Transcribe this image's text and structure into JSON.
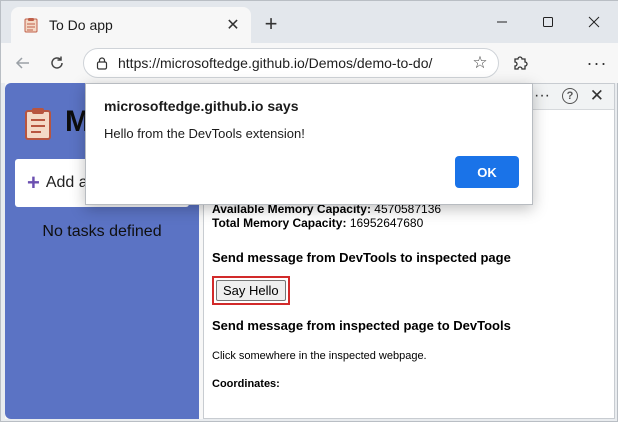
{
  "tab": {
    "title": "To Do app"
  },
  "toolbar": {
    "url": "https://microsoftedge.github.io/Demos/demo-to-do/"
  },
  "todo": {
    "heading": "M",
    "add_label": "Add a",
    "empty": "No tasks defined"
  },
  "devtools": {
    "memory": [
      {
        "label": "Available Memory Capacity:",
        "value": "4570587136"
      },
      {
        "label": "Total Memory Capacity:",
        "value": "16952647680"
      }
    ],
    "send_to_page_heading": "Send message from DevTools to inspected page",
    "say_hello_label": "Say Hello",
    "send_to_devtools_heading": "Send message from inspected page to DevTools",
    "click_hint": "Click somewhere in the inspected webpage.",
    "coordinates_label": "Coordinates:"
  },
  "dialog": {
    "title": "microsoftedge.github.io says",
    "message": "Hello from the DevTools extension!",
    "ok_label": "OK"
  },
  "colors": {
    "accent": "#1a73e8",
    "app_sidebar": "#5b73c4",
    "highlight": "#d22a2a"
  },
  "icons": [
    "notepad-icon",
    "close-icon",
    "plus-icon",
    "minimize-icon",
    "maximize-icon",
    "back-icon",
    "refresh-icon",
    "lock-icon",
    "star-icon",
    "extension-icon",
    "more-icon",
    "help-icon"
  ]
}
